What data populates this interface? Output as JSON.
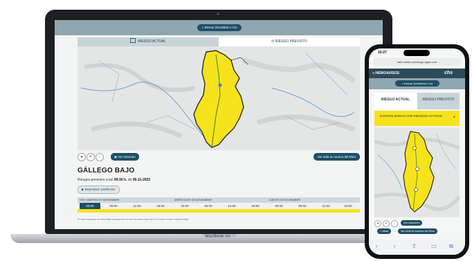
{
  "laptop": {
    "brand": "MacBook Air",
    "search_button": "Buscar (localidad o río)",
    "tabs": [
      {
        "label": "Riesgo actual",
        "icon": "calendar-icon"
      },
      {
        "label": "Riesgo previsto",
        "icon": "forecast-icon"
      }
    ],
    "summary_button": "Ver resumen",
    "basin_button": "Ver toda la cuenca del Ebro",
    "zone_title": "GÁLLEGO BAJO",
    "risk_prefix": "Riesgos previstos a las",
    "risk_time": "09:30 h.",
    "risk_mid": "de",
    "risk_date": "06-11-2023",
    "play_button": "Reproducir predicción",
    "days": [
      "HOY, MARTES 07 NOVIEMBRE",
      "MIÉRCOLES 08 NOVIEMBRE",
      "JUEVES 09 NOVIEMBRE"
    ],
    "hours": [
      "00:00",
      "06:00",
      "12:00",
      "18:00",
      "00:00",
      "06:00",
      "12:00",
      "18:00",
      "00:00",
      "06:00",
      "12:00",
      "18:00"
    ],
    "selected_hour_index": 0,
    "legend_note": "El color mostrado en esta tabla corresponde al nivel de aviso más alto en el tramo horario seleccionado",
    "risk_color": "#f7e31c"
  },
  "phone": {
    "time": "10:27",
    "url": "saih.chebro.es/riesgo-agua.com",
    "brand": "≡ HIDROAVISOS",
    "logo": "chs",
    "search_button": "Buscar (localidad o río)",
    "tabs": [
      "RIESGO ACTUAL",
      "RIESGO PREVISTO"
    ],
    "alert": "EXISTEN ZONAS CON RIESGOS ACTIVOS",
    "alert_close": "×",
    "summary_button": "Ver resumen",
    "back_button": "< atrás",
    "basin_button": "Ver toda la cuenca del Ebro",
    "nav_icons": [
      "back-icon",
      "forward-icon",
      "share-icon",
      "bookmarks-icon",
      "tabs-icon"
    ]
  },
  "colors": {
    "accent": "#1f4e66",
    "header": "#8fa7b0",
    "warning_yellow": "#f7e31c"
  }
}
